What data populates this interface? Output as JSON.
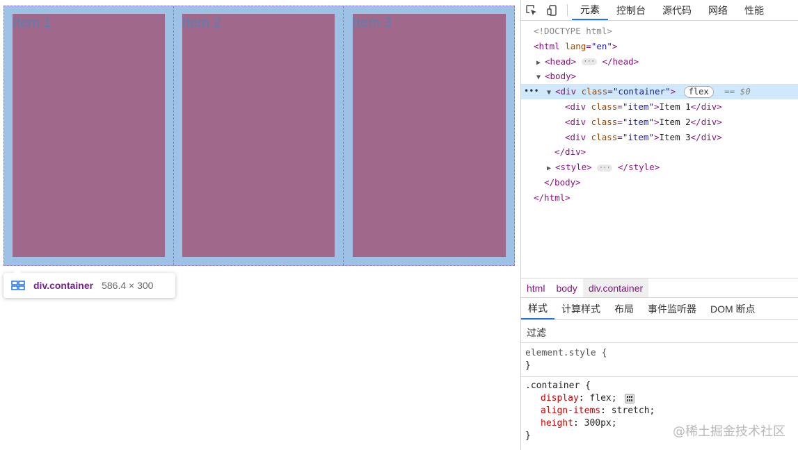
{
  "page": {
    "items": [
      {
        "label": "Item 1"
      },
      {
        "label": "Item 2"
      },
      {
        "label": "Item 3"
      }
    ],
    "tooltip": {
      "name": "div.container",
      "size": "586.4 × 300"
    }
  },
  "devtools": {
    "tabs": [
      "元素",
      "控制台",
      "源代码",
      "网络",
      "性能"
    ],
    "active_tab": "元素",
    "dom": {
      "doctype": "<!DOCTYPE html>",
      "html_open_tag": "<html",
      "html_lang_attr": "lang",
      "html_lang_val": "\"en\"",
      "head_open": "<head>",
      "head_close": "</head>",
      "body_open": "<body>",
      "container_tag": "<div",
      "class_attr": "class",
      "container_class_val": "\"container\"",
      "flex_badge": "flex",
      "selected_ref": "== $0",
      "item_class_val": "\"item\"",
      "item_texts": [
        "Item 1",
        "Item 2",
        "Item 3"
      ],
      "div_close": "</div>",
      "style_open": "<style>",
      "style_close": "</style>",
      "body_close": "</body>",
      "html_close": "</html>"
    },
    "breadcrumbs": [
      "html",
      "body",
      "div.container"
    ],
    "styles_tabs": [
      "样式",
      "计算样式",
      "布局",
      "事件监听器",
      "DOM 断点"
    ],
    "filter_label": "过滤",
    "rules": {
      "element_style": "element.style {",
      "close_brace": "}",
      "container_selector": ".container {",
      "props": [
        {
          "name": "display",
          "value": "flex;"
        },
        {
          "name": "align-items",
          "value": "stretch;"
        },
        {
          "name": "height",
          "value": "300px;"
        }
      ]
    },
    "watermark": "@稀土掘金技术社区"
  }
}
